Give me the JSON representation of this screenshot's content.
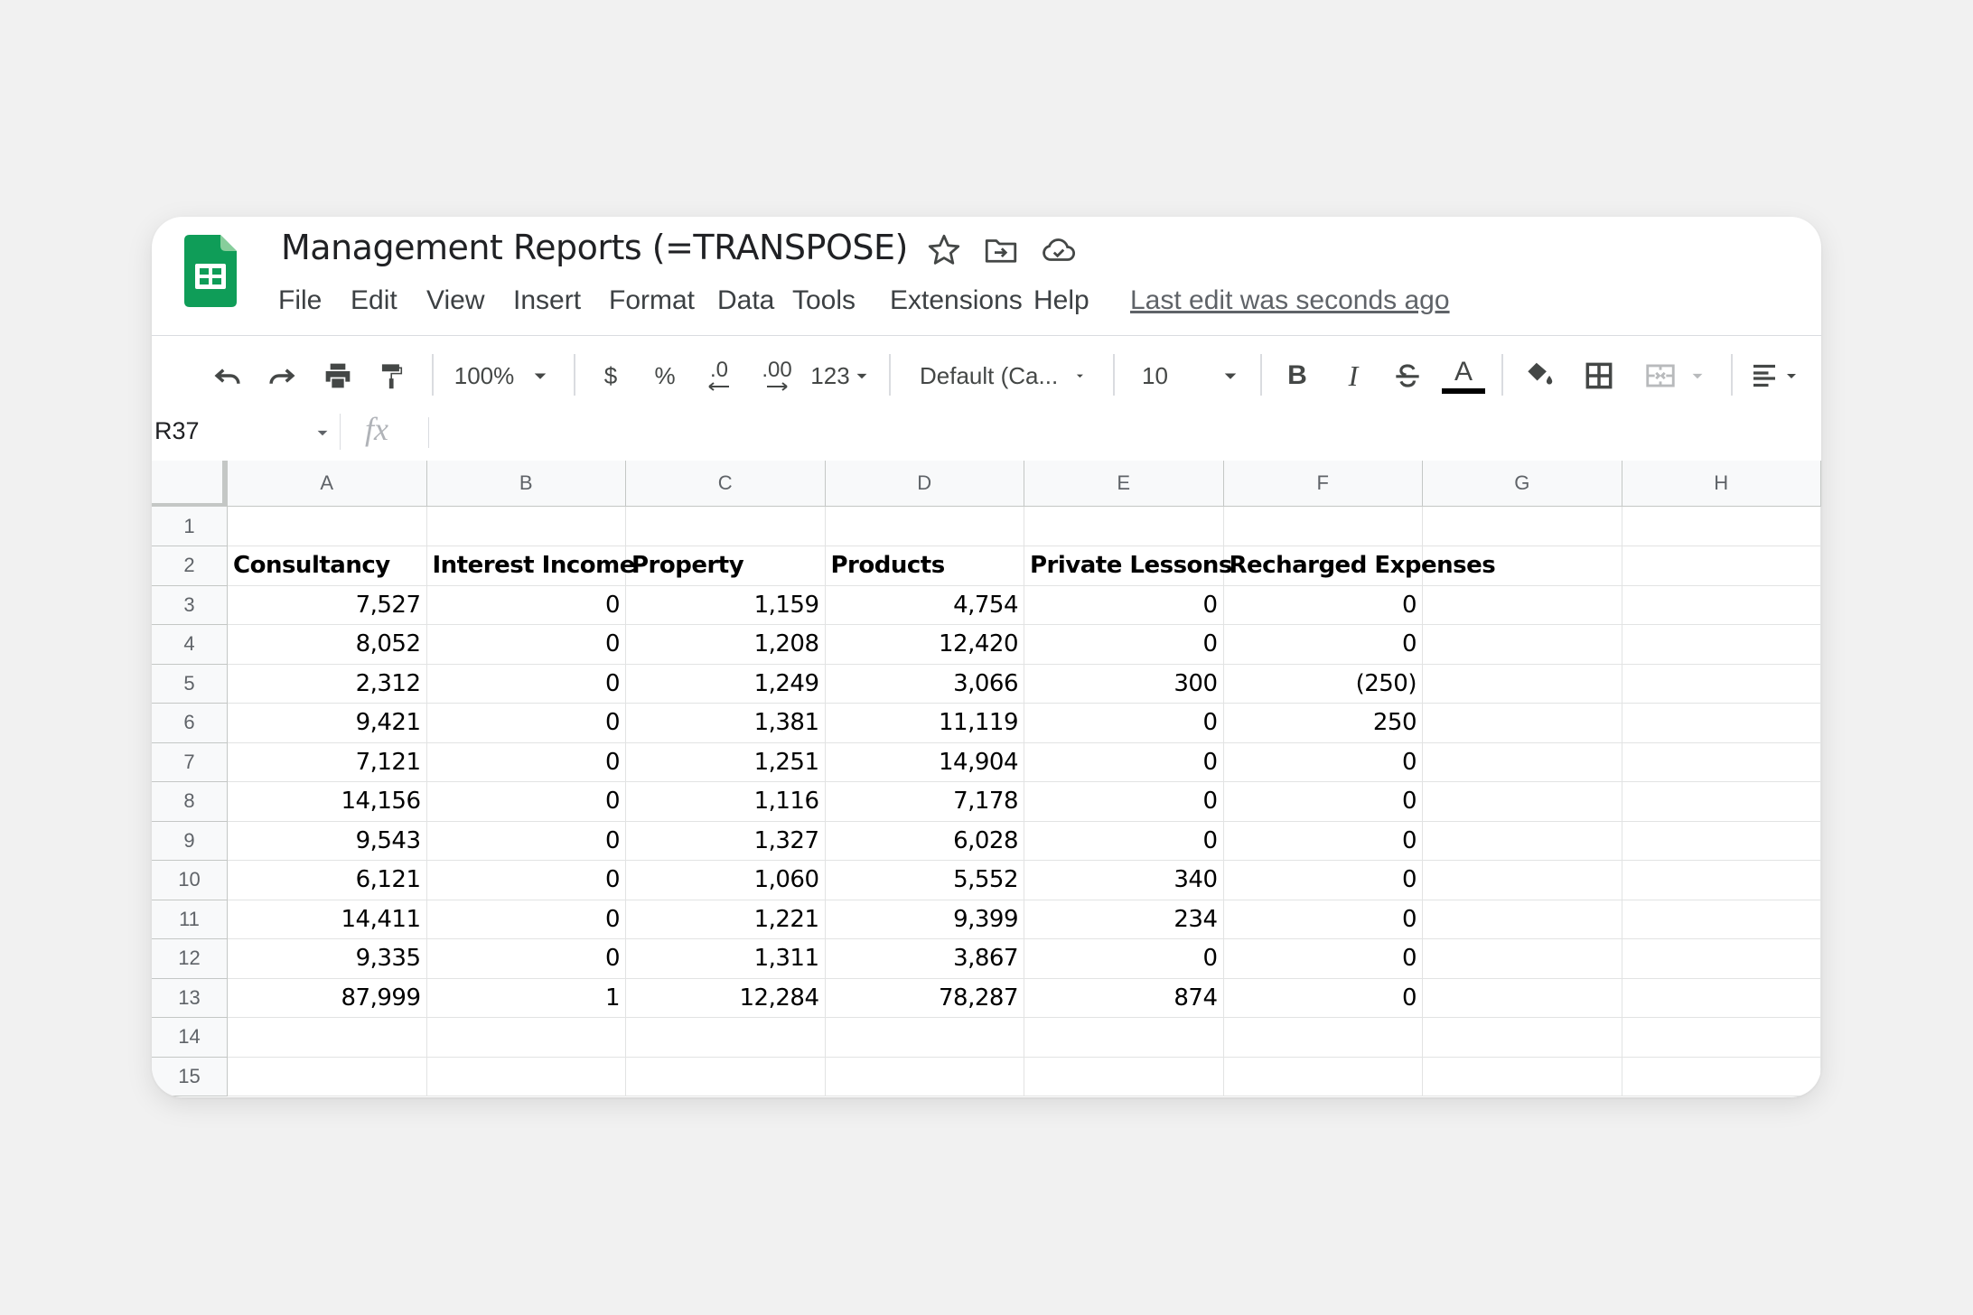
{
  "app": {
    "title": "Management Reports (=TRANSPOSE)",
    "menu": [
      "File",
      "Edit",
      "View",
      "Insert",
      "Format",
      "Data",
      "Tools",
      "Extensions",
      "Help"
    ],
    "last_edit": "Last edit was seconds ago"
  },
  "toolbar": {
    "zoom": "100%",
    "currency": "$",
    "percent": "%",
    "decrease_decimal": ".0",
    "increase_decimal": ".00",
    "number_format": "123",
    "font": "Default (Ca...",
    "font_size": "10",
    "bold": "B",
    "italic": "I",
    "text_color_letter": "A",
    "text_color": "#000000"
  },
  "formula_bar": {
    "name_box": "R37",
    "fx_label": "fx",
    "value": ""
  },
  "sheet": {
    "columns": [
      "A",
      "B",
      "C",
      "D",
      "E",
      "F",
      "G",
      "H"
    ],
    "rows": [
      "1",
      "2",
      "3",
      "4",
      "5",
      "6",
      "7",
      "8",
      "9",
      "10",
      "11",
      "12",
      "13",
      "14",
      "15"
    ],
    "headers": [
      "Consultancy",
      "Interest Income",
      "Property",
      "Products",
      "Private Lessons",
      "Recharged Expenses"
    ],
    "data": [
      [
        "7,527",
        "0",
        "1,159",
        "4,754",
        "0",
        "0"
      ],
      [
        "8,052",
        "0",
        "1,208",
        "12,420",
        "0",
        "0"
      ],
      [
        "2,312",
        "0",
        "1,249",
        "3,066",
        "300",
        "(250)"
      ],
      [
        "9,421",
        "0",
        "1,381",
        "11,119",
        "0",
        "250"
      ],
      [
        "7,121",
        "0",
        "1,251",
        "14,904",
        "0",
        "0"
      ],
      [
        "14,156",
        "0",
        "1,116",
        "7,178",
        "0",
        "0"
      ],
      [
        "9,543",
        "0",
        "1,327",
        "6,028",
        "0",
        "0"
      ],
      [
        "6,121",
        "0",
        "1,060",
        "5,552",
        "340",
        "0"
      ],
      [
        "14,411",
        "0",
        "1,221",
        "9,399",
        "234",
        "0"
      ],
      [
        "9,335",
        "0",
        "1,311",
        "3,867",
        "0",
        "0"
      ],
      [
        "87,999",
        "1",
        "12,284",
        "78,287",
        "874",
        "0"
      ]
    ]
  },
  "colors": {
    "logo_green": "#0f9d58",
    "background": "#f1f1f1",
    "header_fill": "#f8f9fa"
  }
}
